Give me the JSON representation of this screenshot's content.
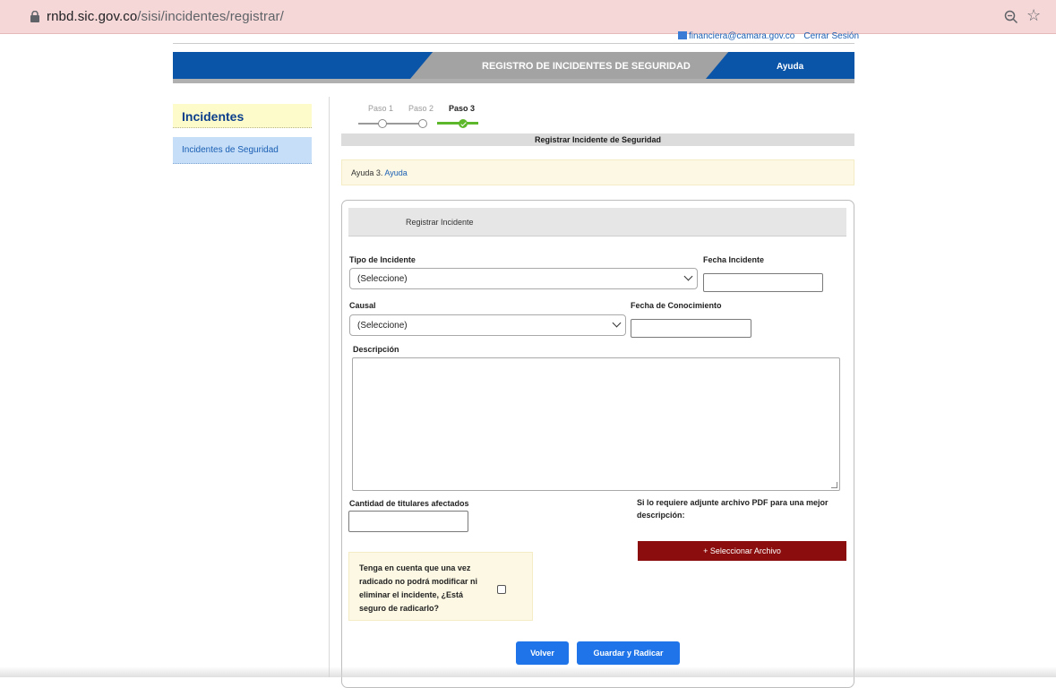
{
  "browser": {
    "url_host": "rnbd.sic.gov.co",
    "url_path": "/sisi/incidentes/registrar/"
  },
  "header": {
    "user_email": "financiera@camara.gov.co",
    "logout_label": "Cerrar Sesión",
    "banner_title": "REGISTRO DE INCIDENTES DE SEGURIDAD",
    "banner_help": "Ayuda"
  },
  "sidebar": {
    "title": "Incidentes",
    "items": [
      {
        "label": "Incidentes de Seguridad"
      }
    ]
  },
  "steps": [
    {
      "label": "Paso 1",
      "state": "inactive"
    },
    {
      "label": "Paso 2",
      "state": "inactive"
    },
    {
      "label": "Paso 3",
      "state": "active"
    }
  ],
  "section_title": "Registrar Incidente de Seguridad",
  "help": {
    "prefix": "Ayuda 3.",
    "link": "Ayuda"
  },
  "form": {
    "panel_title": "Registrar Incidente",
    "tipo_label": "Tipo de Incidente",
    "tipo_value": "(Seleccione)",
    "fecha_incidente_label": "Fecha Incidente",
    "fecha_incidente_value": "",
    "causal_label": "Causal",
    "causal_value": "(Seleccione)",
    "fecha_conocimiento_label": "Fecha de Conocimiento",
    "fecha_conocimiento_value": "",
    "descripcion_label": "Descripción",
    "descripcion_value": "",
    "titulares_label": "Cantidad de titulares afectados",
    "titulares_value": "",
    "pdf_label_line1": "Si lo requiere adjunte archivo PDF para una mejor",
    "pdf_label_line2": "descripción:",
    "file_button": "+ Seleccionar Archivo",
    "warning_text": "Tenga en cuenta que una vez radicado no podrá modificar ni eliminar el incidente, ¿Está seguro de radicarlo?",
    "confirm_checked": false,
    "back_button": "Volver",
    "submit_button": "Guardar y Radicar"
  },
  "colors": {
    "banner_blue": "#0a55a8",
    "file_button": "#8b0d0d",
    "primary_button": "#1e74e8",
    "step_done": "#5cb82a"
  }
}
